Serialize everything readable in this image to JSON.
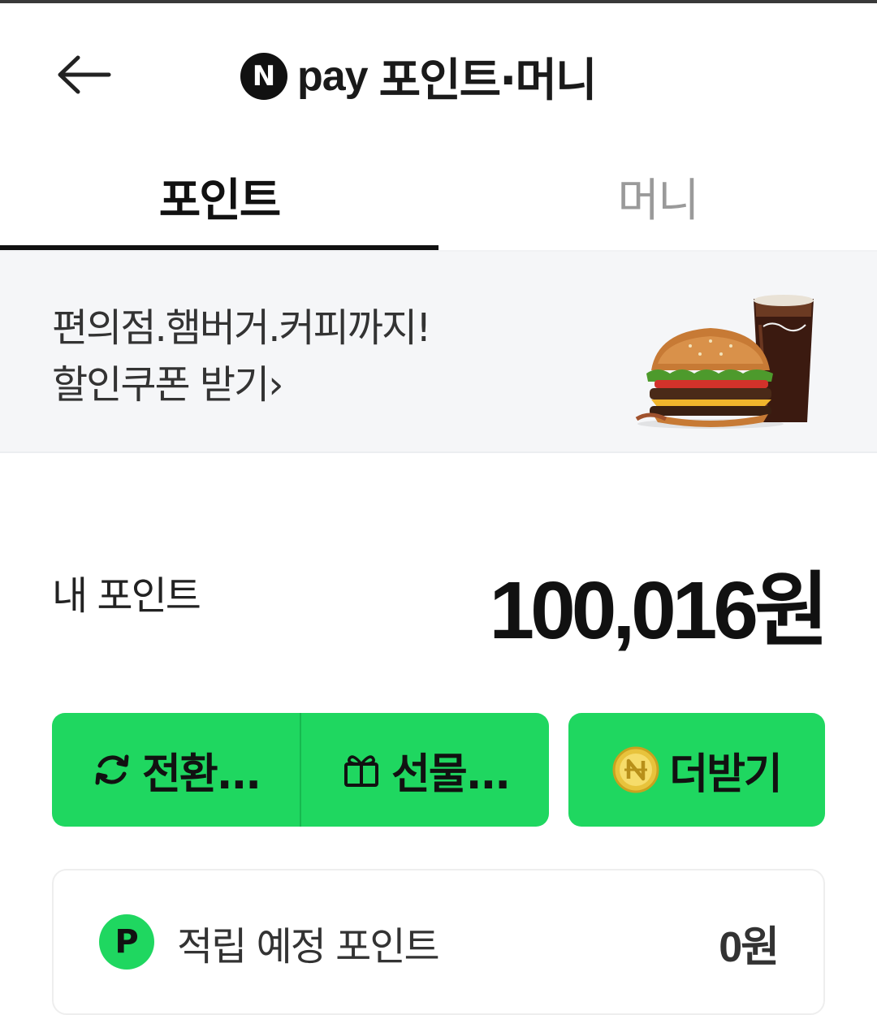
{
  "header": {
    "back_icon": "arrow-left-icon",
    "logo_letter": "N",
    "pay_word": "pay",
    "title": "포인트·머니"
  },
  "tabs": [
    {
      "label": "포인트",
      "active": true
    },
    {
      "label": "머니",
      "active": false
    }
  ],
  "banner": {
    "line1": "편의점.햄버거.커피까지!",
    "line2": "할인쿠폰 받기›",
    "image": "burger-and-cola-image"
  },
  "my_point": {
    "label": "내 포인트",
    "value": "100,016원"
  },
  "actions": {
    "convert_label": "전환...",
    "convert_icon": "refresh-icon",
    "gift_label": "선물...",
    "gift_icon": "gift-icon",
    "more_label": "더받기",
    "more_icon": "npay-coin-icon"
  },
  "pending": {
    "badge": "P",
    "label": "적립 예정 포인트",
    "value": "0원"
  },
  "colors": {
    "accent_green": "#1fd760",
    "banner_bg": "#f5f6f8",
    "tab_inactive": "#9a9a9a"
  }
}
